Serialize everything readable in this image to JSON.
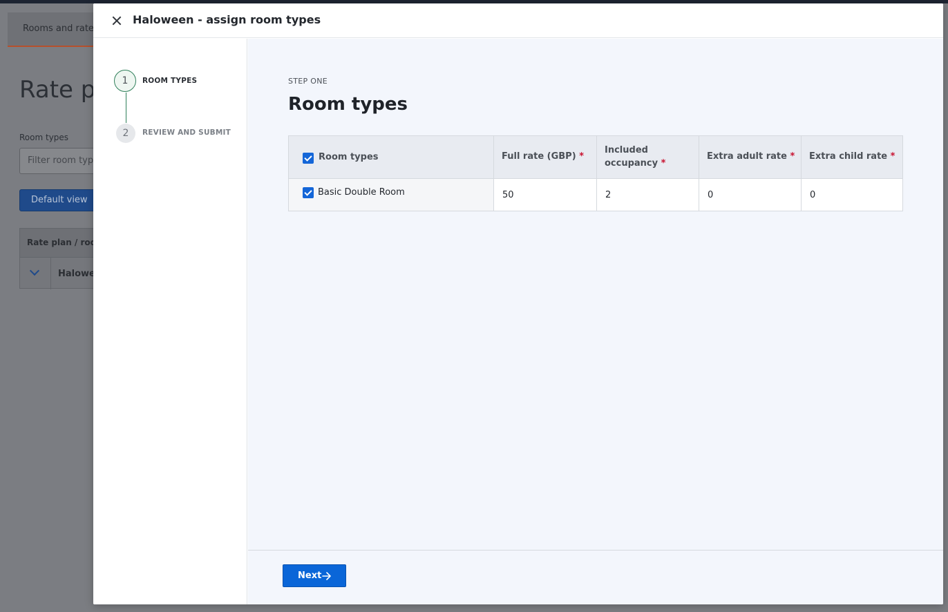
{
  "background": {
    "tab_label": "Rooms and rates",
    "heading": "Rate plans",
    "filter_label": "Room types",
    "filter_placeholder": "Filter room types",
    "view_button": "Default view",
    "table_header": "Rate plan / room type",
    "row_label": "Haloween"
  },
  "modal": {
    "title": "Haloween - assign room types",
    "steps": [
      {
        "number": "1",
        "label": "ROOM TYPES",
        "state": "active"
      },
      {
        "number": "2",
        "label": "REVIEW AND SUBMIT",
        "state": "pending"
      }
    ],
    "eyebrow": "STEP ONE",
    "heading": "Room types",
    "table": {
      "columns": [
        {
          "label": "Room types",
          "required": false,
          "checkbox": true
        },
        {
          "label": "Full rate (GBP)",
          "required": true
        },
        {
          "label": "Included occupancy",
          "required": true
        },
        {
          "label": "Extra adult rate",
          "required": true
        },
        {
          "label": "Extra child rate",
          "required": true
        }
      ],
      "rows": [
        {
          "name": "Basic Double Room",
          "checked": true,
          "full_rate": "50",
          "included_occupancy": "2",
          "extra_adult_rate": "0",
          "extra_child_rate": "0"
        }
      ]
    },
    "next_button": "Next"
  },
  "colors": {
    "primary": "#0a66d8",
    "step_active": "#2f7f5a",
    "required": "#c8102e"
  }
}
